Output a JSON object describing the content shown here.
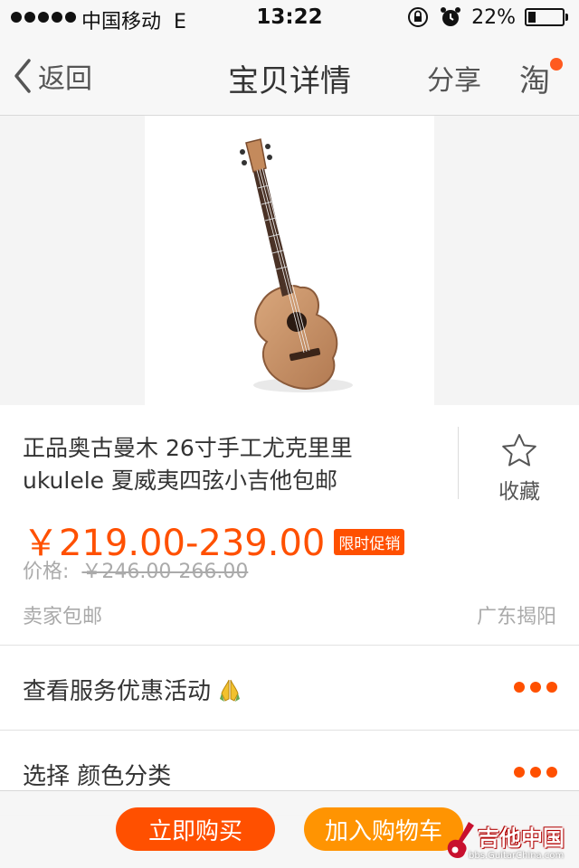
{
  "status_bar": {
    "carrier": "中国移动",
    "network": "E",
    "time": "13:22",
    "battery_percent": "22%",
    "battery_level": 0.22,
    "icons": [
      "signal-dots",
      "rotation-lock-icon",
      "alarm-clock-icon",
      "battery-icon"
    ]
  },
  "nav": {
    "back_label": "返回",
    "title": "宝贝详情",
    "share_label": "分享",
    "taobao_label": "淘",
    "accent": "#ff5a1f"
  },
  "product": {
    "title_line1": "正品奥古曼木 26寸手工尤克里里",
    "title_line2": "ukulele 夏威夷四弦小吉他包邮",
    "favorite_label": "收藏",
    "price": "￥219.00-239.00",
    "promo_badge": "限时促销",
    "original_label": "价格:",
    "original_price": "￥246.00-266.00",
    "shipping": "卖家包邮",
    "location": "广东揭阳"
  },
  "rows": {
    "services_label": "查看服务优惠活动",
    "select_label": "选择 颜色分类"
  },
  "actions": {
    "buy_now": "立即购买",
    "add_to_cart": "加入购物车"
  },
  "watermark": {
    "title": "吉他中国",
    "url": "bbs.GuitarChina.com"
  },
  "colors": {
    "price": "#ff5000",
    "buy_button": "#ff5000",
    "cart_button": "#ff9402",
    "more_dots": "#ff5000"
  }
}
